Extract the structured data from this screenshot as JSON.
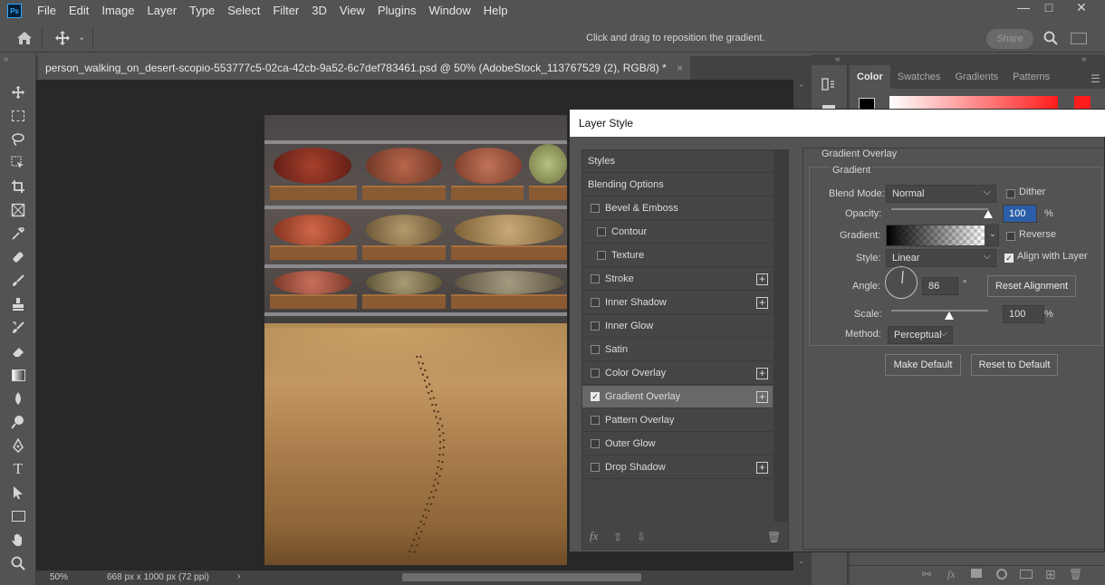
{
  "menubar": {
    "logo": "Ps",
    "items": [
      "File",
      "Edit",
      "Image",
      "Layer",
      "Type",
      "Select",
      "Filter",
      "3D",
      "View",
      "Plugins",
      "Window",
      "Help"
    ]
  },
  "options_bar": {
    "hint": "Click and drag to reposition the gradient.",
    "share_label": "Share"
  },
  "document": {
    "tab_title": "person_walking_on_desert-scopio-553777c5-02ca-42cb-9a52-6c7def783461.psd @ 50% (AdobeStock_113767529 (2), RGB/8) *",
    "close": "×"
  },
  "status": {
    "zoom": "50%",
    "dimensions": "668 px x 1000 px (72 ppi)",
    "arrow": "›"
  },
  "panels": {
    "tabs": [
      "Color",
      "Swatches",
      "Gradients",
      "Patterns"
    ],
    "active_tab": "Color",
    "accent": "#ff1c1c"
  },
  "dialog": {
    "title": "Layer Style",
    "styles": [
      {
        "label": "Styles",
        "header": true
      },
      {
        "label": "Blending Options",
        "header": true
      },
      {
        "label": "Bevel & Emboss",
        "checked": false,
        "plus": false
      },
      {
        "label": "Contour",
        "checked": false,
        "plus": false,
        "indent": true
      },
      {
        "label": "Texture",
        "checked": false,
        "plus": false,
        "indent": true
      },
      {
        "label": "Stroke",
        "checked": false,
        "plus": true
      },
      {
        "label": "Inner Shadow",
        "checked": false,
        "plus": true
      },
      {
        "label": "Inner Glow",
        "checked": false,
        "plus": false
      },
      {
        "label": "Satin",
        "checked": false,
        "plus": false
      },
      {
        "label": "Color Overlay",
        "checked": false,
        "plus": true
      },
      {
        "label": "Gradient Overlay",
        "checked": true,
        "plus": true,
        "selected": true
      },
      {
        "label": "Pattern Overlay",
        "checked": false,
        "plus": false
      },
      {
        "label": "Outer Glow",
        "checked": false,
        "plus": false
      },
      {
        "label": "Drop Shadow",
        "checked": false,
        "plus": true
      }
    ],
    "footer": {
      "fx": "fx",
      "up": "⇧",
      "down": "⇩",
      "trash": "🗑"
    },
    "settings": {
      "section_title": "Gradient Overlay",
      "group_title": "Gradient",
      "blend_mode_label": "Blend Mode:",
      "blend_mode_value": "Normal",
      "dither_label": "Dither",
      "opacity_label": "Opacity:",
      "opacity_value": "100",
      "opacity_fraction": 1.0,
      "percent": "%",
      "reverse_label": "Reverse",
      "gradient_label": "Gradient:",
      "style_label": "Style:",
      "style_value": "Linear",
      "align_label": "Align with Layer",
      "angle_label": "Angle:",
      "angle_value": "86",
      "degree": "°",
      "reset_alignment_label": "Reset Alignment",
      "scale_label": "Scale:",
      "scale_value": "100",
      "scale_fraction": 0.6,
      "method_label": "Method:",
      "method_value": "Perceptual",
      "make_default_label": "Make Default",
      "reset_default_label": "Reset to Default"
    }
  }
}
